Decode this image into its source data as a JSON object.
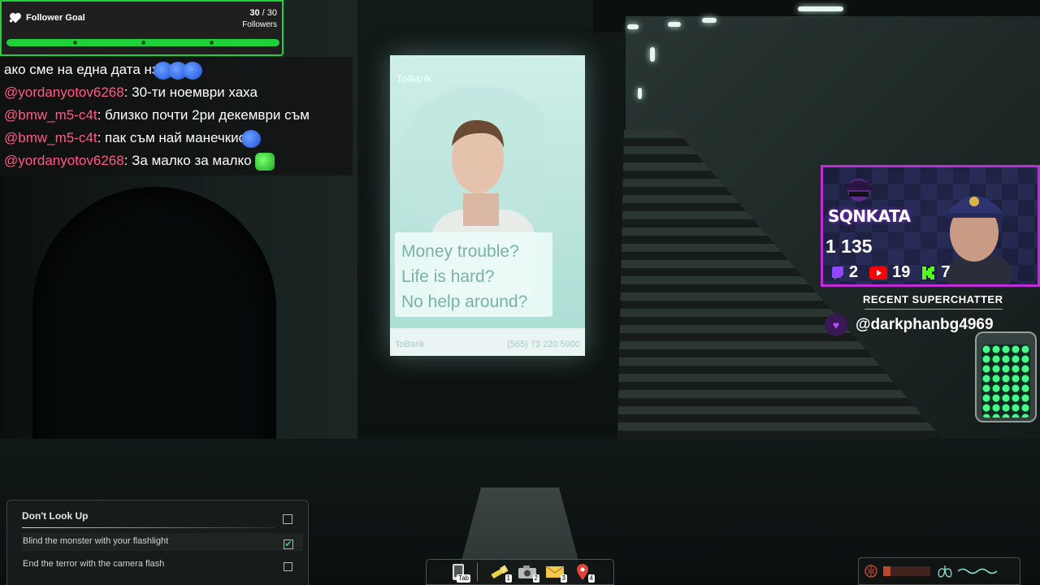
{
  "follower_goal": {
    "title": "Follower Goal",
    "current": "30",
    "separator": " / ",
    "target": "30",
    "unit": "Followers",
    "progress_fraction": 1.0,
    "accent_color": "#1fd23a"
  },
  "chat": {
    "username_color": "#ff5b86",
    "messages": [
      {
        "user": "",
        "text": "ако сме на една дата нз",
        "emotes": [
          "blue-emote",
          "blue-emote",
          "blue-emote"
        ]
      },
      {
        "user": "@yordanyotov6268",
        "text": ": 30-ти ноември хаха",
        "emotes": []
      },
      {
        "user": "@bmw_m5-c4t",
        "text": ": близко почти 2ри декември съм",
        "emotes": []
      },
      {
        "user": "@bmw_m5-c4t",
        "text": ": пак съм най манечкио",
        "emotes": [
          "blue-emote"
        ]
      },
      {
        "user": "@yordanyotov6268",
        "text": ": За малко за малко",
        "emotes": [
          "green-emote"
        ]
      }
    ]
  },
  "poster": {
    "brand": "ToBank",
    "lines": [
      "Money trouble?",
      "Life is hard?",
      "No help around?"
    ],
    "footer_brand": "ToBank",
    "phone": "(565) 73 220 5900"
  },
  "objectives": {
    "title": "Don't Look Up",
    "items": [
      {
        "label": "Blind the monster with your flashlight",
        "done": true
      },
      {
        "label": "End the terror with the camera flash",
        "done": false
      }
    ]
  },
  "hotbar": {
    "slots": [
      {
        "icon": "phone-icon",
        "key": "Tab"
      },
      {
        "icon": "flashlight-icon",
        "key": "1"
      },
      {
        "icon": "camera-icon",
        "key": "2"
      },
      {
        "icon": "envelope-icon",
        "key": "3"
      },
      {
        "icon": "map-pin-icon",
        "key": "4"
      }
    ]
  },
  "stream_overlay": {
    "streamer": "SQNKATA",
    "total": "1 135",
    "stats": [
      {
        "platform": "twitch",
        "icon": "twitch-icon",
        "value": "2"
      },
      {
        "platform": "youtube",
        "icon": "youtube-icon",
        "value": "19"
      },
      {
        "platform": "kick",
        "icon": "kick-icon",
        "value": "7"
      }
    ],
    "frame_color": "#c12bd8",
    "recent_superchatter_title": "RECENT SUPERCHATTER",
    "recent_superchatter_name": "@darkphanbg4969"
  },
  "meters": {
    "stress_fraction": 0.15,
    "icons": [
      "brain-icon",
      "lungs-icon",
      "breath-wave-icon"
    ]
  }
}
